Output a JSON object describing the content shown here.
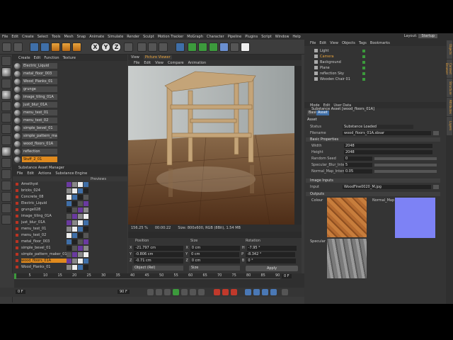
{
  "menu": [
    "File",
    "Edit",
    "Create",
    "Select",
    "Tools",
    "Mesh",
    "Snap",
    "Animate",
    "Simulate",
    "Render",
    "Sculpt",
    "Motion Tracker",
    "MoGraph",
    "Character",
    "Pipeline",
    "Plugins",
    "Script",
    "Window",
    "Help"
  ],
  "layout": {
    "label": "Layout:",
    "value": "Startup"
  },
  "toolbar": {
    "x": "X",
    "y": "Y",
    "z": "Z"
  },
  "material_manager": {
    "menu": [
      "Create",
      "Edit",
      "Function",
      "Texture"
    ],
    "items": [
      "Electric_Liquid",
      "metal_floor_003",
      "Wood_Planks_01",
      "grunge",
      "image_tiling_01A",
      "just_blur_01A",
      "menu_test_01",
      "menu_test_02",
      "simple_bevel_01",
      "simple_pattern_maker_01A",
      "wood_floors_01A",
      "reflection",
      "Stuff_2_01"
    ],
    "active": "Stuff_2_01"
  },
  "substance_manager": {
    "title": "Substance Asset Manager",
    "menu": [
      "File",
      "Edit",
      "Actions",
      "Substance Engine"
    ],
    "col_previews": "Previews",
    "items": [
      "Amethyst",
      "bricks_024",
      "Concrete_08",
      "Electric_Liquid",
      "grunge028",
      "image_tiling_01A",
      "just_blur_01A",
      "menu_test_01",
      "menu_test_02",
      "metal_floor_003",
      "simple_bevel_01",
      "simple_pattern_maker_01A",
      "wood_floors_01A",
      "Wood_Planks_01"
    ],
    "active": "wood_floors_01A"
  },
  "viewport": {
    "menu": [
      "View",
      "Picture Viewer",
      "File",
      "Edit",
      "View",
      "Compare",
      "Animation"
    ],
    "zoom": "156.25 %",
    "time": "00:00:22",
    "size": "Size: 800x600, RGB (8Bit), 1.54 MB"
  },
  "coords": {
    "headers": {
      "position": "Position",
      "size": "Size",
      "rotation": "Rotation"
    },
    "rows": [
      {
        "axis": "X",
        "pos": "-21.797 cm",
        "size_axis": "X",
        "size": "0 cm",
        "rot_axis": "H",
        "rot": "-7.95 °"
      },
      {
        "axis": "Y",
        "pos": "-0.806 cm",
        "size_axis": "Y",
        "size": "0 cm",
        "rot_axis": "P",
        "rot": "-8.342 °"
      },
      {
        "axis": "Z",
        "pos": "-0.71 cm",
        "size_axis": "Z",
        "size": "0 cm",
        "rot_axis": "B",
        "rot": "0 °"
      }
    ],
    "mode": "Object (Rel)",
    "size_mode": "Size",
    "apply": "Apply"
  },
  "timeline": {
    "ticks": [
      "0",
      "5",
      "10",
      "15",
      "20",
      "25",
      "30",
      "35",
      "40",
      "45",
      "50",
      "55",
      "60",
      "65",
      "70",
      "75",
      "80",
      "85",
      "90"
    ],
    "start": "0 F",
    "end": "90 F",
    "current": "0 F",
    "frame_right": "0 F"
  },
  "object_manager": {
    "menu": [
      "File",
      "Edit",
      "View",
      "Objects",
      "Tags",
      "Bookmarks"
    ],
    "objects": [
      "Light",
      "Camera",
      "Background",
      "Plane",
      "reflection Sky",
      "Wooden Chair 01"
    ],
    "active": "Camera"
  },
  "attributes": {
    "menu": [
      "Mode",
      "Edit",
      "User Data"
    ],
    "title": "Substance Asset [wood_floors_01A]",
    "tabs": [
      "Basic",
      "Asset"
    ],
    "active_tab": "Asset",
    "section": "Asset",
    "status_label": "Status",
    "status": "Substance Loaded",
    "filename_label": "Filename",
    "filename": "wood_floors_01A.sbsar",
    "basic_props": "Basic Properties",
    "props": [
      {
        "label": "Width",
        "value": "2048"
      },
      {
        "label": "Height",
        "value": "2048"
      },
      {
        "label": "Random Seed",
        "value": "0"
      },
      {
        "label": "Specular_Blur_Intensity",
        "value": "5"
      },
      {
        "label": "Normal_Map_Intensity",
        "value": "0.05"
      }
    ],
    "image_inputs": "Image Inputs",
    "input_label": "Input",
    "input_value": "WoodFine0020_M.jpg",
    "outputs": "Outputs",
    "out_labels": [
      "Colour",
      "Normal_Map",
      "Specular"
    ]
  },
  "side_tabs": [
    "Objects",
    "Content Browser",
    "Structure",
    "Attributes",
    "Layers"
  ],
  "colors": {
    "accent": "#e08a1e",
    "selection": "#3f6fa8",
    "panel": "#343434"
  }
}
